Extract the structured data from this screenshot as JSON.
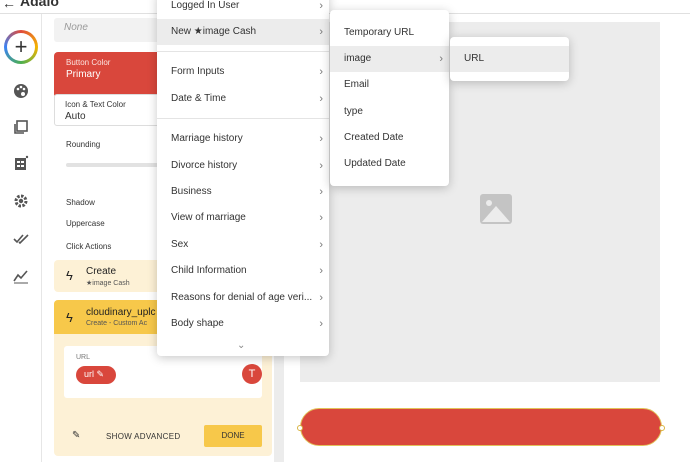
{
  "app": {
    "title": "Adalo"
  },
  "panel": {
    "none_placeholder": "None",
    "button_color": {
      "label": "Button Color",
      "value": "Primary"
    },
    "icon_text_color": {
      "label": "Icon & Text Color",
      "value": "Auto"
    },
    "rounding_label": "Rounding",
    "shadow_label": "Shadow",
    "uppercase_label": "Uppercase",
    "click_actions_label": "Click Actions",
    "action_create": {
      "title": "Create",
      "subtitle": "★image Cash"
    },
    "action_custom": {
      "title": "cloudinary_uplc",
      "subtitle": "Create - Custom Ac"
    },
    "url_label": "URL",
    "url_chip": "url",
    "show_advanced": "SHOW ADVANCED",
    "done": "DONE"
  },
  "menu1": {
    "items": [
      {
        "label": "Logged In User",
        "submenu": true
      },
      {
        "label": "New ★image Cash",
        "submenu": true,
        "highlighted": true
      },
      {
        "label": "Form Inputs",
        "submenu": true
      },
      {
        "label": "Date & Time",
        "submenu": true
      },
      {
        "label": "Marriage history",
        "submenu": true
      },
      {
        "label": "Divorce history",
        "submenu": true
      },
      {
        "label": "Business",
        "submenu": true
      },
      {
        "label": "View of marriage",
        "submenu": true
      },
      {
        "label": "Sex",
        "submenu": true
      },
      {
        "label": "Child Information",
        "submenu": true
      },
      {
        "label": "Reasons for denial of age veri...",
        "submenu": true
      },
      {
        "label": "Body shape",
        "submenu": true
      }
    ]
  },
  "menu2": {
    "items": [
      {
        "label": "Temporary URL"
      },
      {
        "label": "image",
        "submenu": true,
        "highlighted": true
      },
      {
        "label": "Email"
      },
      {
        "label": "type"
      },
      {
        "label": "Created Date"
      },
      {
        "label": "Updated Date"
      }
    ]
  },
  "menu3": {
    "items": [
      {
        "label": "URL",
        "highlighted": true
      }
    ]
  },
  "colors": {
    "accent_red": "#d9473c",
    "action_yellow": "#f7c84a",
    "action_bg": "#fdf1d6"
  }
}
